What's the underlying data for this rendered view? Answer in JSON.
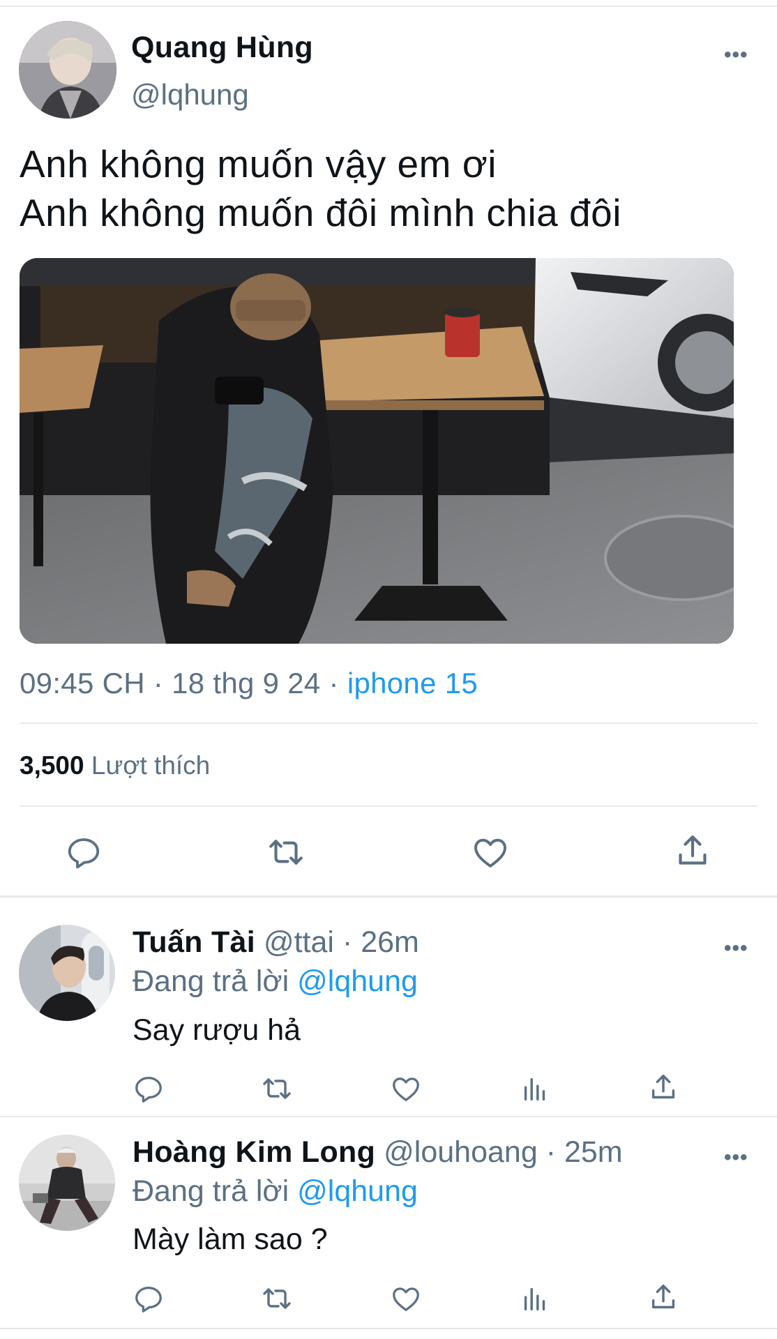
{
  "tweet": {
    "author_name": "Quang Hùng",
    "author_handle": "@lqhung",
    "more_icon": "ellipsis-icon",
    "text_lines": [
      "Anh không muốn vậy em ơi",
      "Anh không muốn đôi mình chia đôi"
    ],
    "photo_icon": "photo",
    "time": "09:45 CH",
    "separator": " · ",
    "date": "18 thg 9 24",
    "source": "iphone 15",
    "likes_count": "3,500",
    "likes_label": "Lượt thích",
    "actions": [
      "reply-icon",
      "retweet-icon",
      "like-icon",
      "share-icon"
    ]
  },
  "replies": [
    {
      "name": "Tuấn Tài",
      "handle": "@ttai",
      "time": "26m",
      "replying_label": "Đang trả lời",
      "replying_to": "@lqhung",
      "text": "Say rượu hả"
    },
    {
      "name": "Hoàng Kim Long",
      "handle": "@louhoang",
      "time": "25m",
      "replying_label": "Đang trả lời",
      "replying_to": "@lqhung",
      "text": "Mày làm sao ?"
    }
  ],
  "reply_actions": [
    "reply-icon",
    "retweet-icon",
    "like-icon",
    "analytics-icon",
    "share-icon"
  ],
  "colors": {
    "text": "#0f1419",
    "secondary": "#5b7083",
    "accent": "#1d9bf0",
    "divider": "#e6e9ec"
  }
}
